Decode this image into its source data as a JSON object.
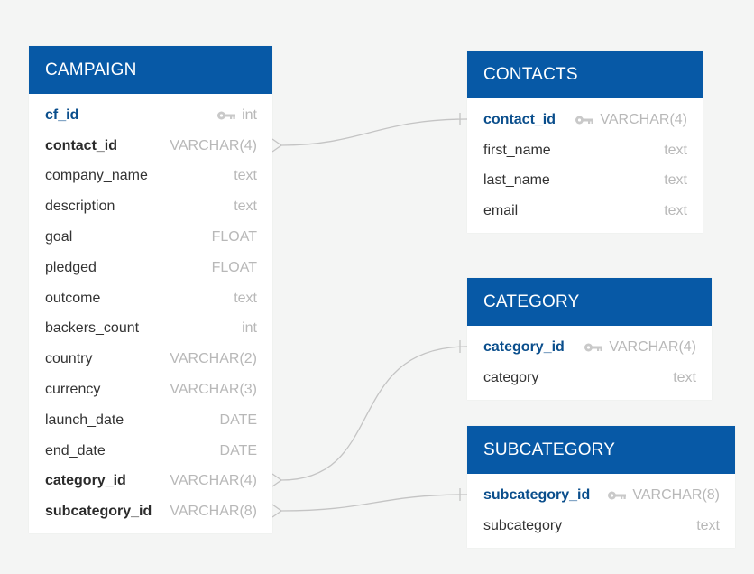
{
  "colors": {
    "header": "#0759a6",
    "pk_text": "#0a4e8c",
    "type_text": "#b8b8b8",
    "connector": "#c4c4c4",
    "background": "#f4f5f4"
  },
  "tables": {
    "campaign": {
      "title": "CAMPAIGN",
      "fields": [
        {
          "name": "cf_id",
          "type": "int",
          "style": "pk",
          "key_icon": true
        },
        {
          "name": "contact_id",
          "type": "VARCHAR(4)",
          "style": "bold"
        },
        {
          "name": "company_name",
          "type": "text",
          "style": "normal"
        },
        {
          "name": "description",
          "type": "text",
          "style": "normal"
        },
        {
          "name": "goal",
          "type": "FLOAT",
          "style": "normal"
        },
        {
          "name": "pledged",
          "type": "FLOAT",
          "style": "normal"
        },
        {
          "name": "outcome",
          "type": "text",
          "style": "normal"
        },
        {
          "name": "backers_count",
          "type": "int",
          "style": "normal"
        },
        {
          "name": "country",
          "type": "VARCHAR(2)",
          "style": "normal"
        },
        {
          "name": "currency",
          "type": "VARCHAR(3)",
          "style": "normal"
        },
        {
          "name": "launch_date",
          "type": "DATE",
          "style": "normal"
        },
        {
          "name": "end_date",
          "type": "DATE",
          "style": "normal"
        },
        {
          "name": "category_id",
          "type": "VARCHAR(4)",
          "style": "bold"
        },
        {
          "name": "subcategory_id",
          "type": "VARCHAR(8)",
          "style": "bold"
        }
      ]
    },
    "contacts": {
      "title": "CONTACTS",
      "fields": [
        {
          "name": "contact_id",
          "type": "VARCHAR(4)",
          "style": "pk",
          "key_icon": true
        },
        {
          "name": "first_name",
          "type": "text",
          "style": "normal"
        },
        {
          "name": "last_name",
          "type": "text",
          "style": "normal"
        },
        {
          "name": "email",
          "type": "text",
          "style": "normal"
        }
      ]
    },
    "category": {
      "title": "CATEGORY",
      "fields": [
        {
          "name": "category_id",
          "type": "VARCHAR(4)",
          "style": "pk",
          "key_icon": true
        },
        {
          "name": "category",
          "type": "text",
          "style": "normal"
        }
      ]
    },
    "subcategory": {
      "title": "SUBCATEGORY",
      "fields": [
        {
          "name": "subcategory_id",
          "type": "VARCHAR(8)",
          "style": "pk",
          "key_icon": true
        },
        {
          "name": "subcategory",
          "type": "text",
          "style": "normal"
        }
      ]
    }
  },
  "relationships": [
    {
      "from": "campaign.contact_id",
      "to": "contacts.contact_id",
      "from_end": "many",
      "to_end": "one"
    },
    {
      "from": "campaign.category_id",
      "to": "category.category_id",
      "from_end": "many",
      "to_end": "one"
    },
    {
      "from": "campaign.subcategory_id",
      "to": "subcategory.subcategory_id",
      "from_end": "many",
      "to_end": "one"
    }
  ]
}
